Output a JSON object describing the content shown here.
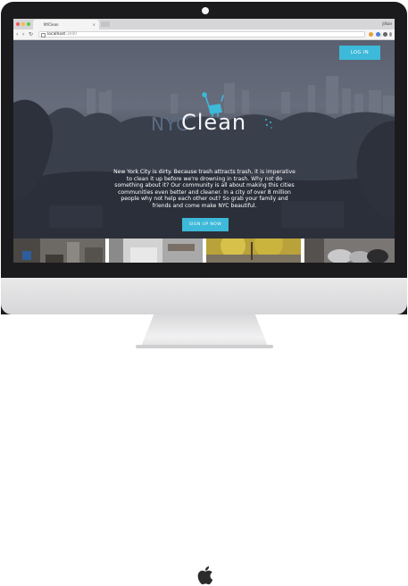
{
  "browser": {
    "tab_title": "NYClean",
    "tab_close": "×",
    "profile": "Jillian",
    "url_host": "localhost",
    "url_port": ":3000",
    "star": "☆",
    "back": "‹",
    "forward": "›",
    "reload": "↻"
  },
  "header": {
    "login_label": "LOG IN"
  },
  "hero": {
    "logo_nyc": "NYC",
    "logo_clean": "Clean",
    "blurb": "New York City is dirty. Because trash attracts trash, it is imperative to clean it up before we're drowning in trash. Why not do something about it? Our community is all about making this cities communities even better and cleaner. In a city of over 8 million people why not help each other out? So grab your family and friends and come make NYC beautiful.",
    "signup_label": "SIGN UP NOW"
  },
  "colors": {
    "accent": "#3db9d9",
    "logo_nyc": "#5a6c84",
    "logo_clean": "#f2f4f7"
  },
  "gallery": {
    "thumbs": [
      "street-trash-photo",
      "snowy-street-photo",
      "autumn-tree-photo",
      "trash-bags-photo"
    ]
  }
}
